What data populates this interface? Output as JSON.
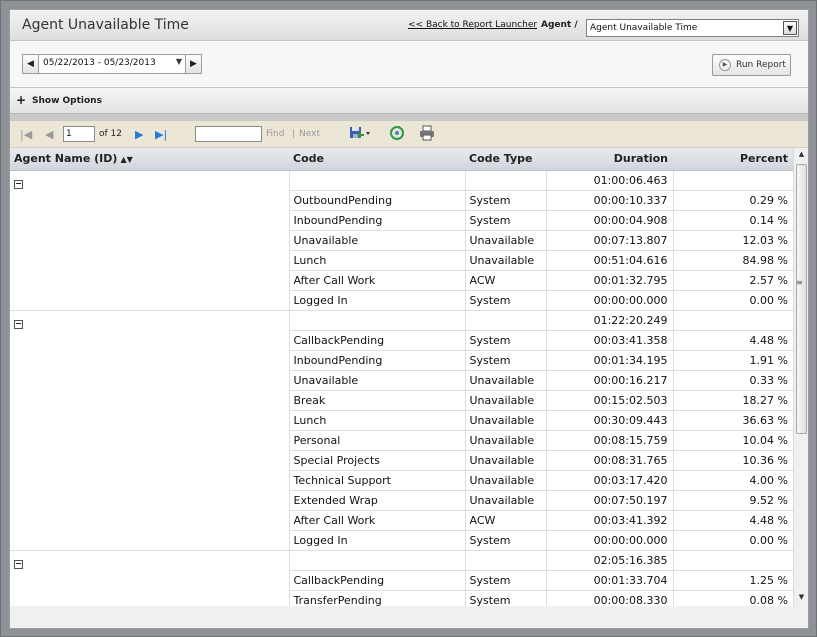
{
  "header": {
    "title": "Agent Unavailable Time",
    "back_link": "<< Back to Report Launcher",
    "agent_label": "Agent /",
    "agent_value": "Agent Unavailable Time"
  },
  "datebar": {
    "date_range": "05/22/2013 - 05/23/2013",
    "run_label": "Run Report"
  },
  "options": {
    "label": "Show Options"
  },
  "toolbar": {
    "page_value": "1",
    "page_of": "of 12",
    "find_label": "Find",
    "separator": "|",
    "next_label": "Next"
  },
  "table": {
    "columns": [
      "Agent Name (ID)",
      "Code",
      "Code Type",
      "Duration",
      "Percent"
    ],
    "groups": [
      {
        "total": "01:00:06.463",
        "rows": [
          {
            "code": "OutboundPending",
            "type": "System",
            "duration": "00:00:10.337",
            "percent": "0.29 %"
          },
          {
            "code": "InboundPending",
            "type": "System",
            "duration": "00:00:04.908",
            "percent": "0.14 %"
          },
          {
            "code": "Unavailable",
            "type": "Unavailable",
            "duration": "00:07:13.807",
            "percent": "12.03 %"
          },
          {
            "code": "Lunch",
            "type": "Unavailable",
            "duration": "00:51:04.616",
            "percent": "84.98 %"
          },
          {
            "code": "After Call Work",
            "type": "ACW",
            "duration": "00:01:32.795",
            "percent": "2.57 %"
          },
          {
            "code": "Logged In",
            "type": "System",
            "duration": "00:00:00.000",
            "percent": "0.00 %"
          }
        ]
      },
      {
        "total": "01:22:20.249",
        "rows": [
          {
            "code": "CallbackPending",
            "type": "System",
            "duration": "00:03:41.358",
            "percent": "4.48 %"
          },
          {
            "code": "InboundPending",
            "type": "System",
            "duration": "00:01:34.195",
            "percent": "1.91 %"
          },
          {
            "code": "Unavailable",
            "type": "Unavailable",
            "duration": "00:00:16.217",
            "percent": "0.33 %"
          },
          {
            "code": "Break",
            "type": "Unavailable",
            "duration": "00:15:02.503",
            "percent": "18.27 %"
          },
          {
            "code": "Lunch",
            "type": "Unavailable",
            "duration": "00:30:09.443",
            "percent": "36.63 %"
          },
          {
            "code": "Personal",
            "type": "Unavailable",
            "duration": "00:08:15.759",
            "percent": "10.04 %"
          },
          {
            "code": "Special Projects",
            "type": "Unavailable",
            "duration": "00:08:31.765",
            "percent": "10.36 %"
          },
          {
            "code": "Technical Support",
            "type": "Unavailable",
            "duration": "00:03:17.420",
            "percent": "4.00 %"
          },
          {
            "code": "Extended Wrap",
            "type": "Unavailable",
            "duration": "00:07:50.197",
            "percent": "9.52 %"
          },
          {
            "code": "After Call Work",
            "type": "ACW",
            "duration": "00:03:41.392",
            "percent": "4.48 %"
          },
          {
            "code": "Logged In",
            "type": "System",
            "duration": "00:00:00.000",
            "percent": "0.00 %"
          }
        ]
      },
      {
        "total": "02:05:16.385",
        "rows": [
          {
            "code": "CallbackPending",
            "type": "System",
            "duration": "00:01:33.704",
            "percent": "1.25 %"
          },
          {
            "code": "TransferPending",
            "type": "System",
            "duration": "00:00:08.330",
            "percent": "0.08 %"
          }
        ]
      }
    ]
  }
}
